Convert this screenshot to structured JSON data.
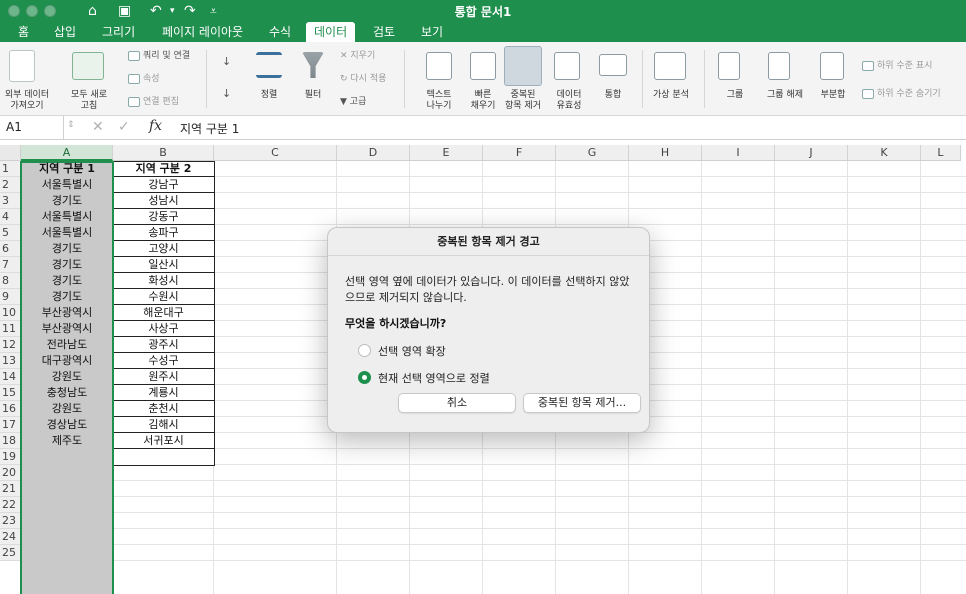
{
  "window": {
    "title": "통합 문서1"
  },
  "menu_tabs": [
    "홈",
    "삽입",
    "그리기",
    "페이지 레이아웃",
    "수식",
    "데이터",
    "검토",
    "보기"
  ],
  "active_tab": "데이터",
  "ribbon": {
    "get_external": "외부 데이터\n가져오기",
    "refresh_all": "모두 새로\n고침",
    "queries_connections": "쿼리 및 연결",
    "properties": "속성",
    "edit_links": "연결 편집",
    "sort": "정렬",
    "filter": "필터",
    "clear": "지우기",
    "reapply": "다시 적용",
    "advanced": "고급",
    "text_to_columns": "텍스트\n나누기",
    "flash_fill": "빠른\n채우기",
    "remove_duplicates": "중복된\n항목 제거",
    "data_validation": "데이터\n유효성",
    "consolidate": "통합",
    "what_if": "가상 분석",
    "group": "그룹",
    "ungroup": "그룹 해제",
    "subtotal": "부분합",
    "show_detail": "하위 수준 표시",
    "hide_detail": "하위 수준 숨기기"
  },
  "formula_bar": {
    "name_box": "A1",
    "fx": "fx",
    "value": "지역 구분 1"
  },
  "columns": [
    "A",
    "B",
    "C",
    "D",
    "E",
    "F",
    "G",
    "H",
    "I",
    "J",
    "K",
    "L"
  ],
  "rows": [
    "1",
    "2",
    "3",
    "4",
    "5",
    "6",
    "7",
    "8",
    "9",
    "10",
    "11",
    "12",
    "13",
    "14",
    "15",
    "16",
    "17",
    "18",
    "19",
    "20",
    "21",
    "22",
    "23",
    "24",
    "25"
  ],
  "sheet": {
    "col_a": [
      "지역 구분 1",
      "서울특별시",
      "경기도",
      "서울특별시",
      "서울특별시",
      "경기도",
      "경기도",
      "경기도",
      "경기도",
      "부산광역시",
      "부산광역시",
      "전라남도",
      "대구광역시",
      "강원도",
      "충청남도",
      "강원도",
      "경상남도",
      "제주도"
    ],
    "col_b": [
      "지역 구분 2",
      "강남구",
      "성남시",
      "강동구",
      "송파구",
      "고양시",
      "일산시",
      "화성시",
      "수원시",
      "해운대구",
      "사상구",
      "광주시",
      "수성구",
      "원주시",
      "계룡시",
      "춘천시",
      "김해시",
      "서귀포시"
    ]
  },
  "dialog": {
    "title": "중복된 항목 제거 경고",
    "message": "선택 영역 옆에 데이터가 있습니다. 이 데이터를 선택하지 않았으므로 제거되지 않습니다.",
    "question": "무엇을 하시겠습니까?",
    "option_expand": "선택 영역 확장",
    "option_current": "현재 선택 영역으로 정렬",
    "selected_option": "현재 선택 영역으로 정렬",
    "cancel": "취소",
    "remove": "중복된 항목 제거..."
  },
  "colors": {
    "accent": "#1f8f4e",
    "selection": "#c9c9c9"
  }
}
